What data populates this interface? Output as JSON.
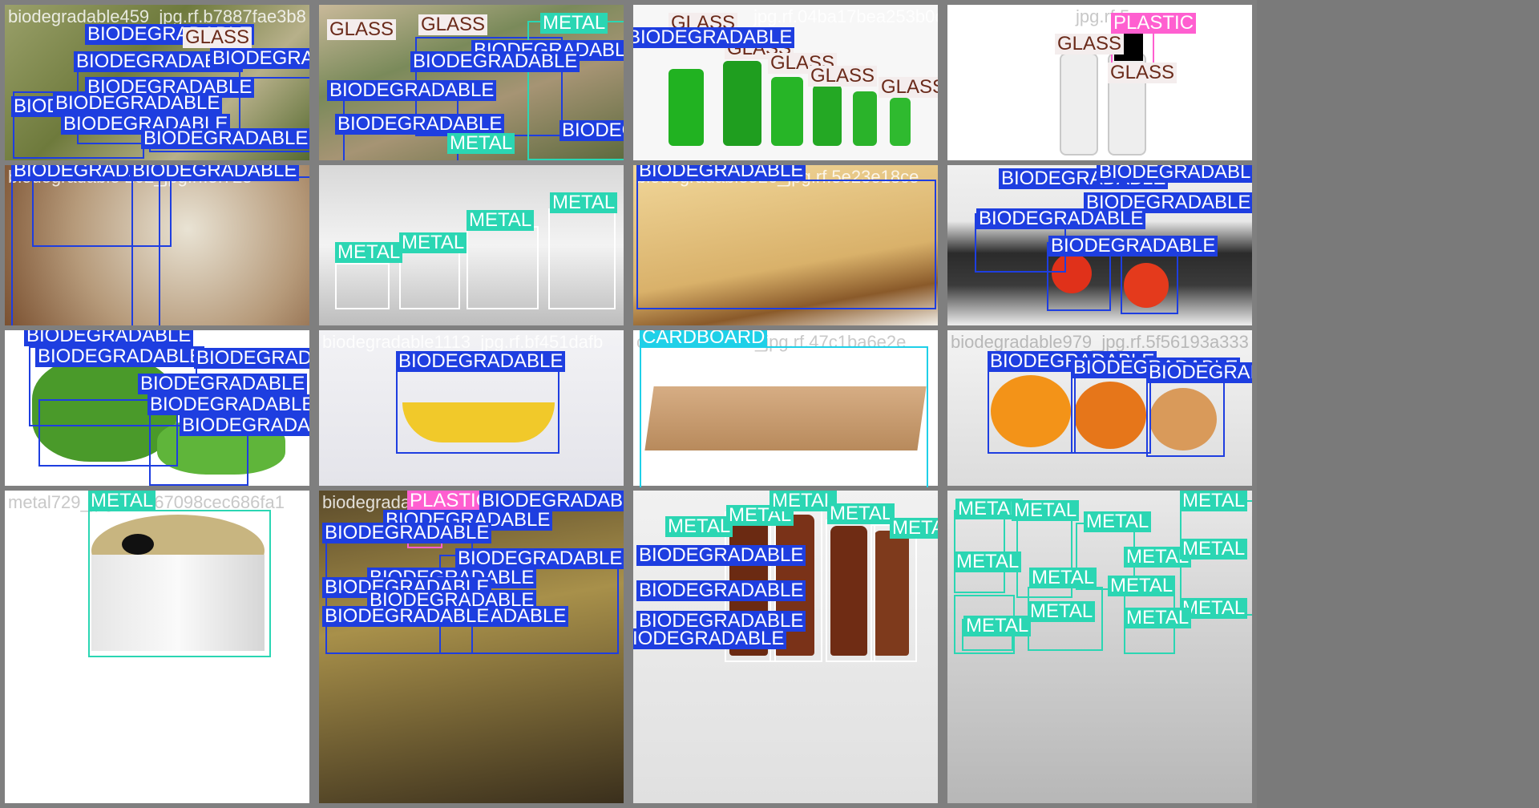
{
  "classes": {
    "bio": "BIODEGRADABLE",
    "glass": "GLASS",
    "metal": "METAL",
    "plastic": "PLASTIC",
    "card": "CARDBOARD"
  },
  "colors": {
    "bio": "#1e3ee0",
    "glass": "#f4eded",
    "metal": "#2bd6b3",
    "plastic": "#ff5fd0",
    "cardboard": "#1fd0e8",
    "tile_border": "#7f7f7f"
  },
  "tiles": [
    {
      "id": "t1",
      "filename": "biodegradable459_jpg.rf.b7887fae3b8",
      "scene": "mixed-vegetables"
    },
    {
      "id": "t2",
      "filename": "",
      "scene": "food-table"
    },
    {
      "id": "t3",
      "filename": "jpg.rf.04ba17bea253b0d4",
      "scene": "green-glass-bottles"
    },
    {
      "id": "t4",
      "filename": "jpg.rf.5c",
      "scene": "clear-vials"
    },
    {
      "id": "t5",
      "filename": "biodegradable 202_jpg.rf.5f725",
      "scene": "moldy-bread"
    },
    {
      "id": "t6",
      "filename": "",
      "scene": "glass-jars"
    },
    {
      "id": "t7",
      "filename": "biodegradable526_jpg.rf.5e23e18ce",
      "scene": "pie-crust"
    },
    {
      "id": "t8",
      "filename": "",
      "scene": "vegetables-plate"
    },
    {
      "id": "t9",
      "filename": "",
      "scene": "bitter-gourd"
    },
    {
      "id": "t10",
      "filename": "biodegradable1113_jpg.rf.bf451dafb",
      "scene": "banana"
    },
    {
      "id": "t11",
      "filename": "cardboard1406_jpg.rf.47c1ba6e2e",
      "scene": "cardboard"
    },
    {
      "id": "t12",
      "filename": "biodegradable979_jpg.rf.5f56193a333",
      "scene": "oranges"
    },
    {
      "id": "t13",
      "filename": "metal729_jpg.rf.7d67098cec686fa1",
      "scene": "tin-can"
    },
    {
      "id": "t14",
      "filename": "biodegradable1027_jpg.rf.7dc1eff4cf8",
      "scene": "food-items"
    },
    {
      "id": "t15",
      "filename": "",
      "scene": "brown-bottles"
    },
    {
      "id": "t16",
      "filename": "",
      "scene": "metal-cans"
    }
  ]
}
